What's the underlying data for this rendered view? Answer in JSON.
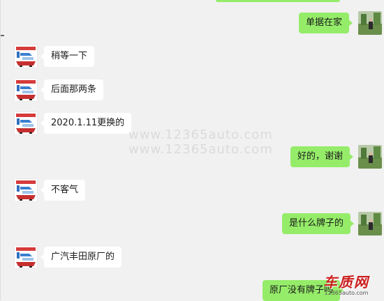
{
  "messages": [
    {
      "side": "out",
      "text": "单据在家"
    },
    {
      "side": "in",
      "text": "稍等一下"
    },
    {
      "side": "in",
      "text": "后面那两条"
    },
    {
      "side": "in",
      "text": "2020.1.11更换的"
    },
    {
      "side": "out",
      "text": "好的，谢谢"
    },
    {
      "side": "in",
      "text": "不客气"
    },
    {
      "side": "out",
      "text": "是什么牌子的"
    },
    {
      "side": "in",
      "text": "广汽丰田原厂的"
    },
    {
      "side": "out",
      "text": "原厂没有牌子吗"
    }
  ],
  "watermark": {
    "line1": "www.12365auto.com",
    "line2": "www.12365auto.com"
  },
  "logo": {
    "name": "车质网",
    "url": "12365auto.com"
  },
  "avatars": {
    "agent": "agent-avatar",
    "user": "user-avatar"
  },
  "colors": {
    "background": "#f1f1f1",
    "incoming_bubble": "#ffffff",
    "outgoing_bubble": "#95ec69",
    "logo_red": "#cc1e1e"
  }
}
